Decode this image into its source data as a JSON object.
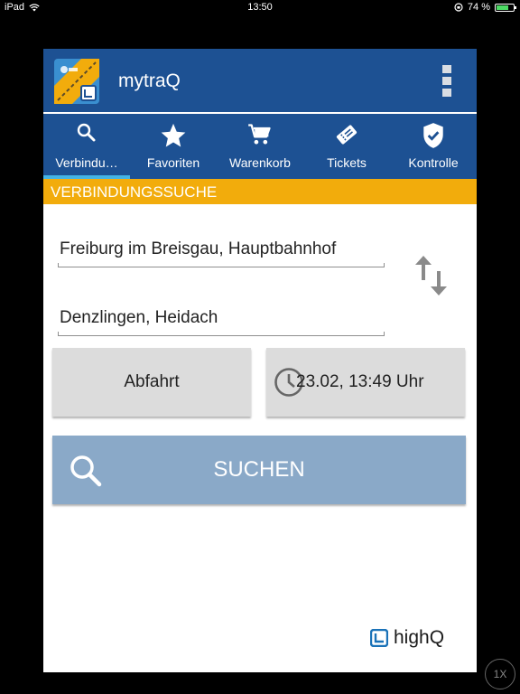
{
  "status_bar": {
    "device": "iPad",
    "time": "13:50",
    "battery_percent_text": "74 %",
    "battery_level": 0.74
  },
  "app": {
    "title": "mytraQ",
    "tabs": [
      {
        "label": "Verbindu…",
        "icon": "search-icon",
        "active": true
      },
      {
        "label": "Favoriten",
        "icon": "star-icon",
        "active": false
      },
      {
        "label": "Warenkorb",
        "icon": "cart-icon",
        "active": false
      },
      {
        "label": "Tickets",
        "icon": "ticket-icon",
        "active": false
      },
      {
        "label": "Kontrolle",
        "icon": "shield-check-icon",
        "active": false
      }
    ],
    "section_title": "VERBINDUNGSSUCHE",
    "from": "Freiburg im Breisgau, Hauptbahnhof",
    "to": "Denzlingen, Heidach",
    "departure_label": "Abfahrt",
    "datetime": "23.02, 13:49 Uhr",
    "search_label": "SUCHEN",
    "brand": "highQ"
  },
  "zoom": "1X",
  "colors": {
    "primary": "#1d5193",
    "accent": "#f2ac0c",
    "tab_indicator": "#44b4e6",
    "search_button": "#8aa9c8"
  }
}
